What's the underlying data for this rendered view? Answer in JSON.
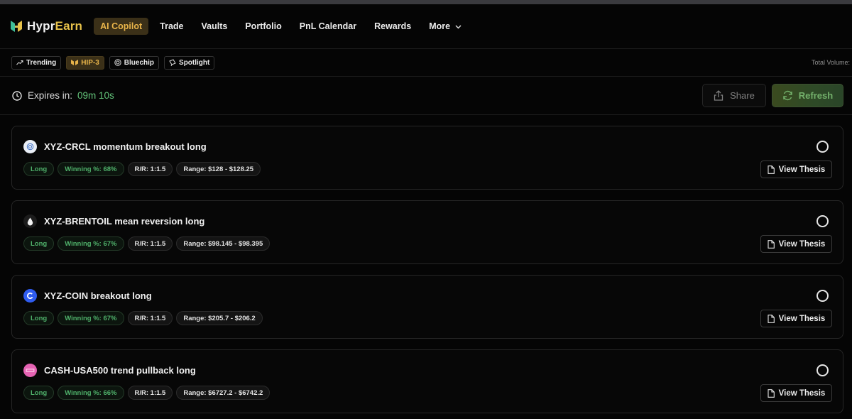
{
  "brand": {
    "part1": "Hypr",
    "part2": "Earn"
  },
  "nav": {
    "items": [
      {
        "label": "AI Copilot",
        "active": true
      },
      {
        "label": "Trade"
      },
      {
        "label": "Vaults"
      },
      {
        "label": "Portfolio"
      },
      {
        "label": "PnL Calendar"
      },
      {
        "label": "Rewards"
      },
      {
        "label": "More"
      }
    ]
  },
  "filters": {
    "chips": [
      {
        "label": "Trending",
        "icon": "trending-icon"
      },
      {
        "label": "HIP-3",
        "icon": "hip3-icon",
        "active": true
      },
      {
        "label": "Bluechip",
        "icon": "bluechip-icon"
      },
      {
        "label": "Spotlight",
        "icon": "spotlight-icon"
      }
    ],
    "total_volume_label": "Total Volume:"
  },
  "expires": {
    "label": "Expires in:",
    "time": "09m 10s"
  },
  "actions": {
    "share_label": "Share",
    "refresh_label": "Refresh"
  },
  "colors": {
    "accent_gold": "#e8b44a",
    "positive_green": "#4fb06a",
    "background": "#050505"
  },
  "cards": [
    {
      "title": "XYZ-CRCL momentum breakout long",
      "icon": "crcl-icon",
      "direction": "Long",
      "winning": "Winning %: 68%",
      "rr": "R/R: 1:1.5",
      "range": "Range: $128 - $128.25",
      "thesis_label": "View Thesis"
    },
    {
      "title": "XYZ-BRENTOIL mean reversion long",
      "icon": "oil-drop-icon",
      "direction": "Long",
      "winning": "Winning %: 67%",
      "rr": "R/R: 1:1.5",
      "range": "Range: $98.145 - $98.395",
      "thesis_label": "View Thesis"
    },
    {
      "title": "XYZ-COIN breakout long",
      "icon": "coinbase-icon",
      "direction": "Long",
      "winning": "Winning %: 67%",
      "rr": "R/R: 1:1.5",
      "range": "Range: $205.7 - $206.2",
      "thesis_label": "View Thesis"
    },
    {
      "title": "CASH-USA500 trend pullback long",
      "icon": "usa500-icon",
      "direction": "Long",
      "winning": "Winning %: 66%",
      "rr": "R/R: 1:1.5",
      "range": "Range: $6727.2 - $6742.2",
      "thesis_label": "View Thesis"
    }
  ]
}
